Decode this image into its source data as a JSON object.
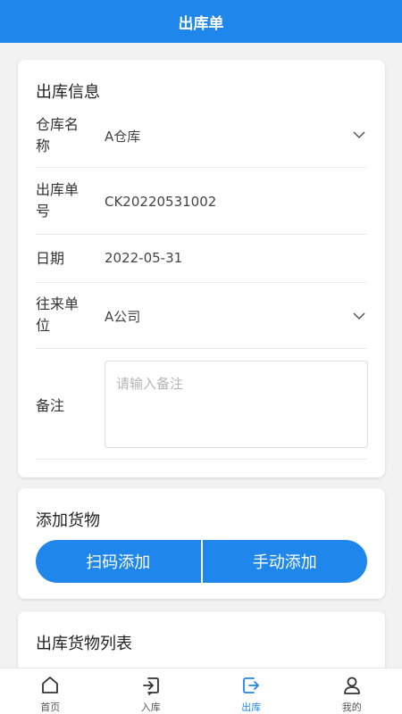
{
  "header": {
    "title": "出库单"
  },
  "info_card": {
    "title": "出库信息",
    "fields": [
      {
        "label": "仓库名称",
        "value": "A仓库",
        "type": "select"
      },
      {
        "label": "出库单号",
        "value": "CK20220531002",
        "type": "text"
      },
      {
        "label": "日期",
        "value": "2022-05-31",
        "type": "text"
      },
      {
        "label": "往来单位",
        "value": "A公司",
        "type": "select"
      }
    ],
    "remark": {
      "label": "备注",
      "placeholder": "请输入备注",
      "value": ""
    }
  },
  "add_card": {
    "title": "添加货物",
    "scan_label": "扫码添加",
    "manual_label": "手动添加"
  },
  "list_card": {
    "title": "出库货物列表"
  },
  "tabbar": {
    "items": [
      {
        "label": "首页",
        "icon": "home-icon",
        "active": false
      },
      {
        "label": "入库",
        "icon": "inbound-icon",
        "active": false
      },
      {
        "label": "出库",
        "icon": "outbound-icon",
        "active": true
      },
      {
        "label": "我的",
        "icon": "user-icon",
        "active": false
      }
    ]
  },
  "colors": {
    "primary": "#1f87eb",
    "background": "#f2f2f2",
    "divider": "#ececec"
  }
}
